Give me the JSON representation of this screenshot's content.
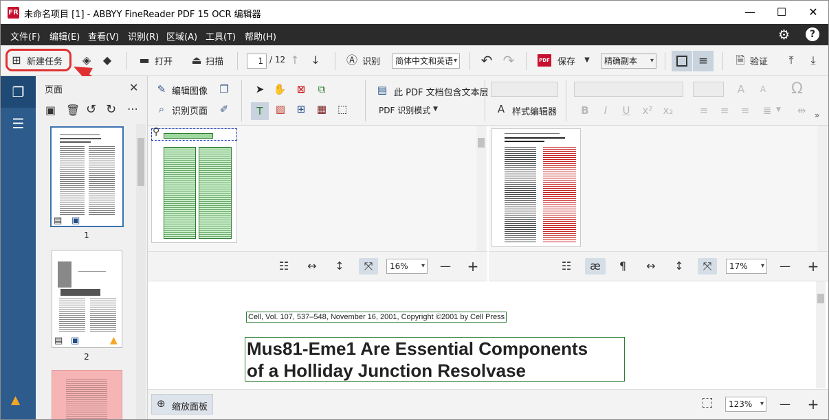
{
  "window": {
    "title": "未命名项目 [1] - ABBYY FineReader PDF 15 OCR 编辑器",
    "app_icon_text": "FR",
    "minimize": "—",
    "maximize": "☐",
    "close": "✕"
  },
  "menu": [
    "文件(F)",
    "编辑(E)",
    "查看(V)",
    "识别(R)",
    "区域(A)",
    "工具(T)",
    "帮助(H)"
  ],
  "toolbar": {
    "new_task": "新建任务",
    "open": "打开",
    "scan": "扫描",
    "page_current": "1",
    "page_total": "/ 12",
    "recognize": "识别",
    "language": "简体中文和英语",
    "save": "保存",
    "save_badge": "PDF",
    "save_mode": "精确副本",
    "verify": "验证"
  },
  "pages_panel": {
    "title": "页面",
    "page1_num": "1",
    "page2_num": "2"
  },
  "ribbon": {
    "edit_image": "编辑图像",
    "recognize_page": "识别页面",
    "pdf_text_layer": "此 PDF 文档包含文本层",
    "pdf_mode": "PDF 识别模式",
    "style_editor": "样式编辑器",
    "omega": "Ω"
  },
  "image_pane": {
    "zoom": "16%"
  },
  "text_pane": {
    "zoom": "17%"
  },
  "zoom_pane": {
    "citation": "Cell, Vol. 107, 537–548, November 16, 2001, Copyright ©2001 by Cell Press",
    "title_line1": "Mus81-Eme1 Are Essential Components",
    "title_line2": "of a Holliday Junction Resolvase",
    "zoom_panel_label": "缩放面板",
    "zoom": "123%"
  },
  "colors": {
    "accent_blue": "#2c5b8c",
    "menu_bg": "#2b2b2b",
    "highlight_red": "#e03030",
    "region_green": "#2e7d32"
  }
}
